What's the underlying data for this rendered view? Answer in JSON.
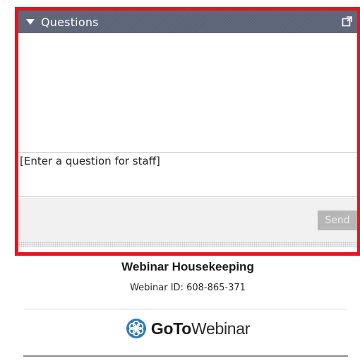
{
  "questions_panel": {
    "title": "Questions",
    "input_placeholder": "[Enter a question for staff]",
    "send_label": "Send"
  },
  "footer": {
    "title": "Webinar Housekeeping",
    "webinar_id": "Webinar ID: 608-865-371",
    "brand_bold": "GoTo",
    "brand_regular": "Webinar"
  },
  "colors": {
    "highlight_border": "#e3161d",
    "header_bg": "#5b6378",
    "logo_blue": "#2f7bbf"
  },
  "icons": {
    "collapse": "triangle-down-icon",
    "popout": "popout-icon",
    "brand_logo": "flower-logo-icon"
  }
}
